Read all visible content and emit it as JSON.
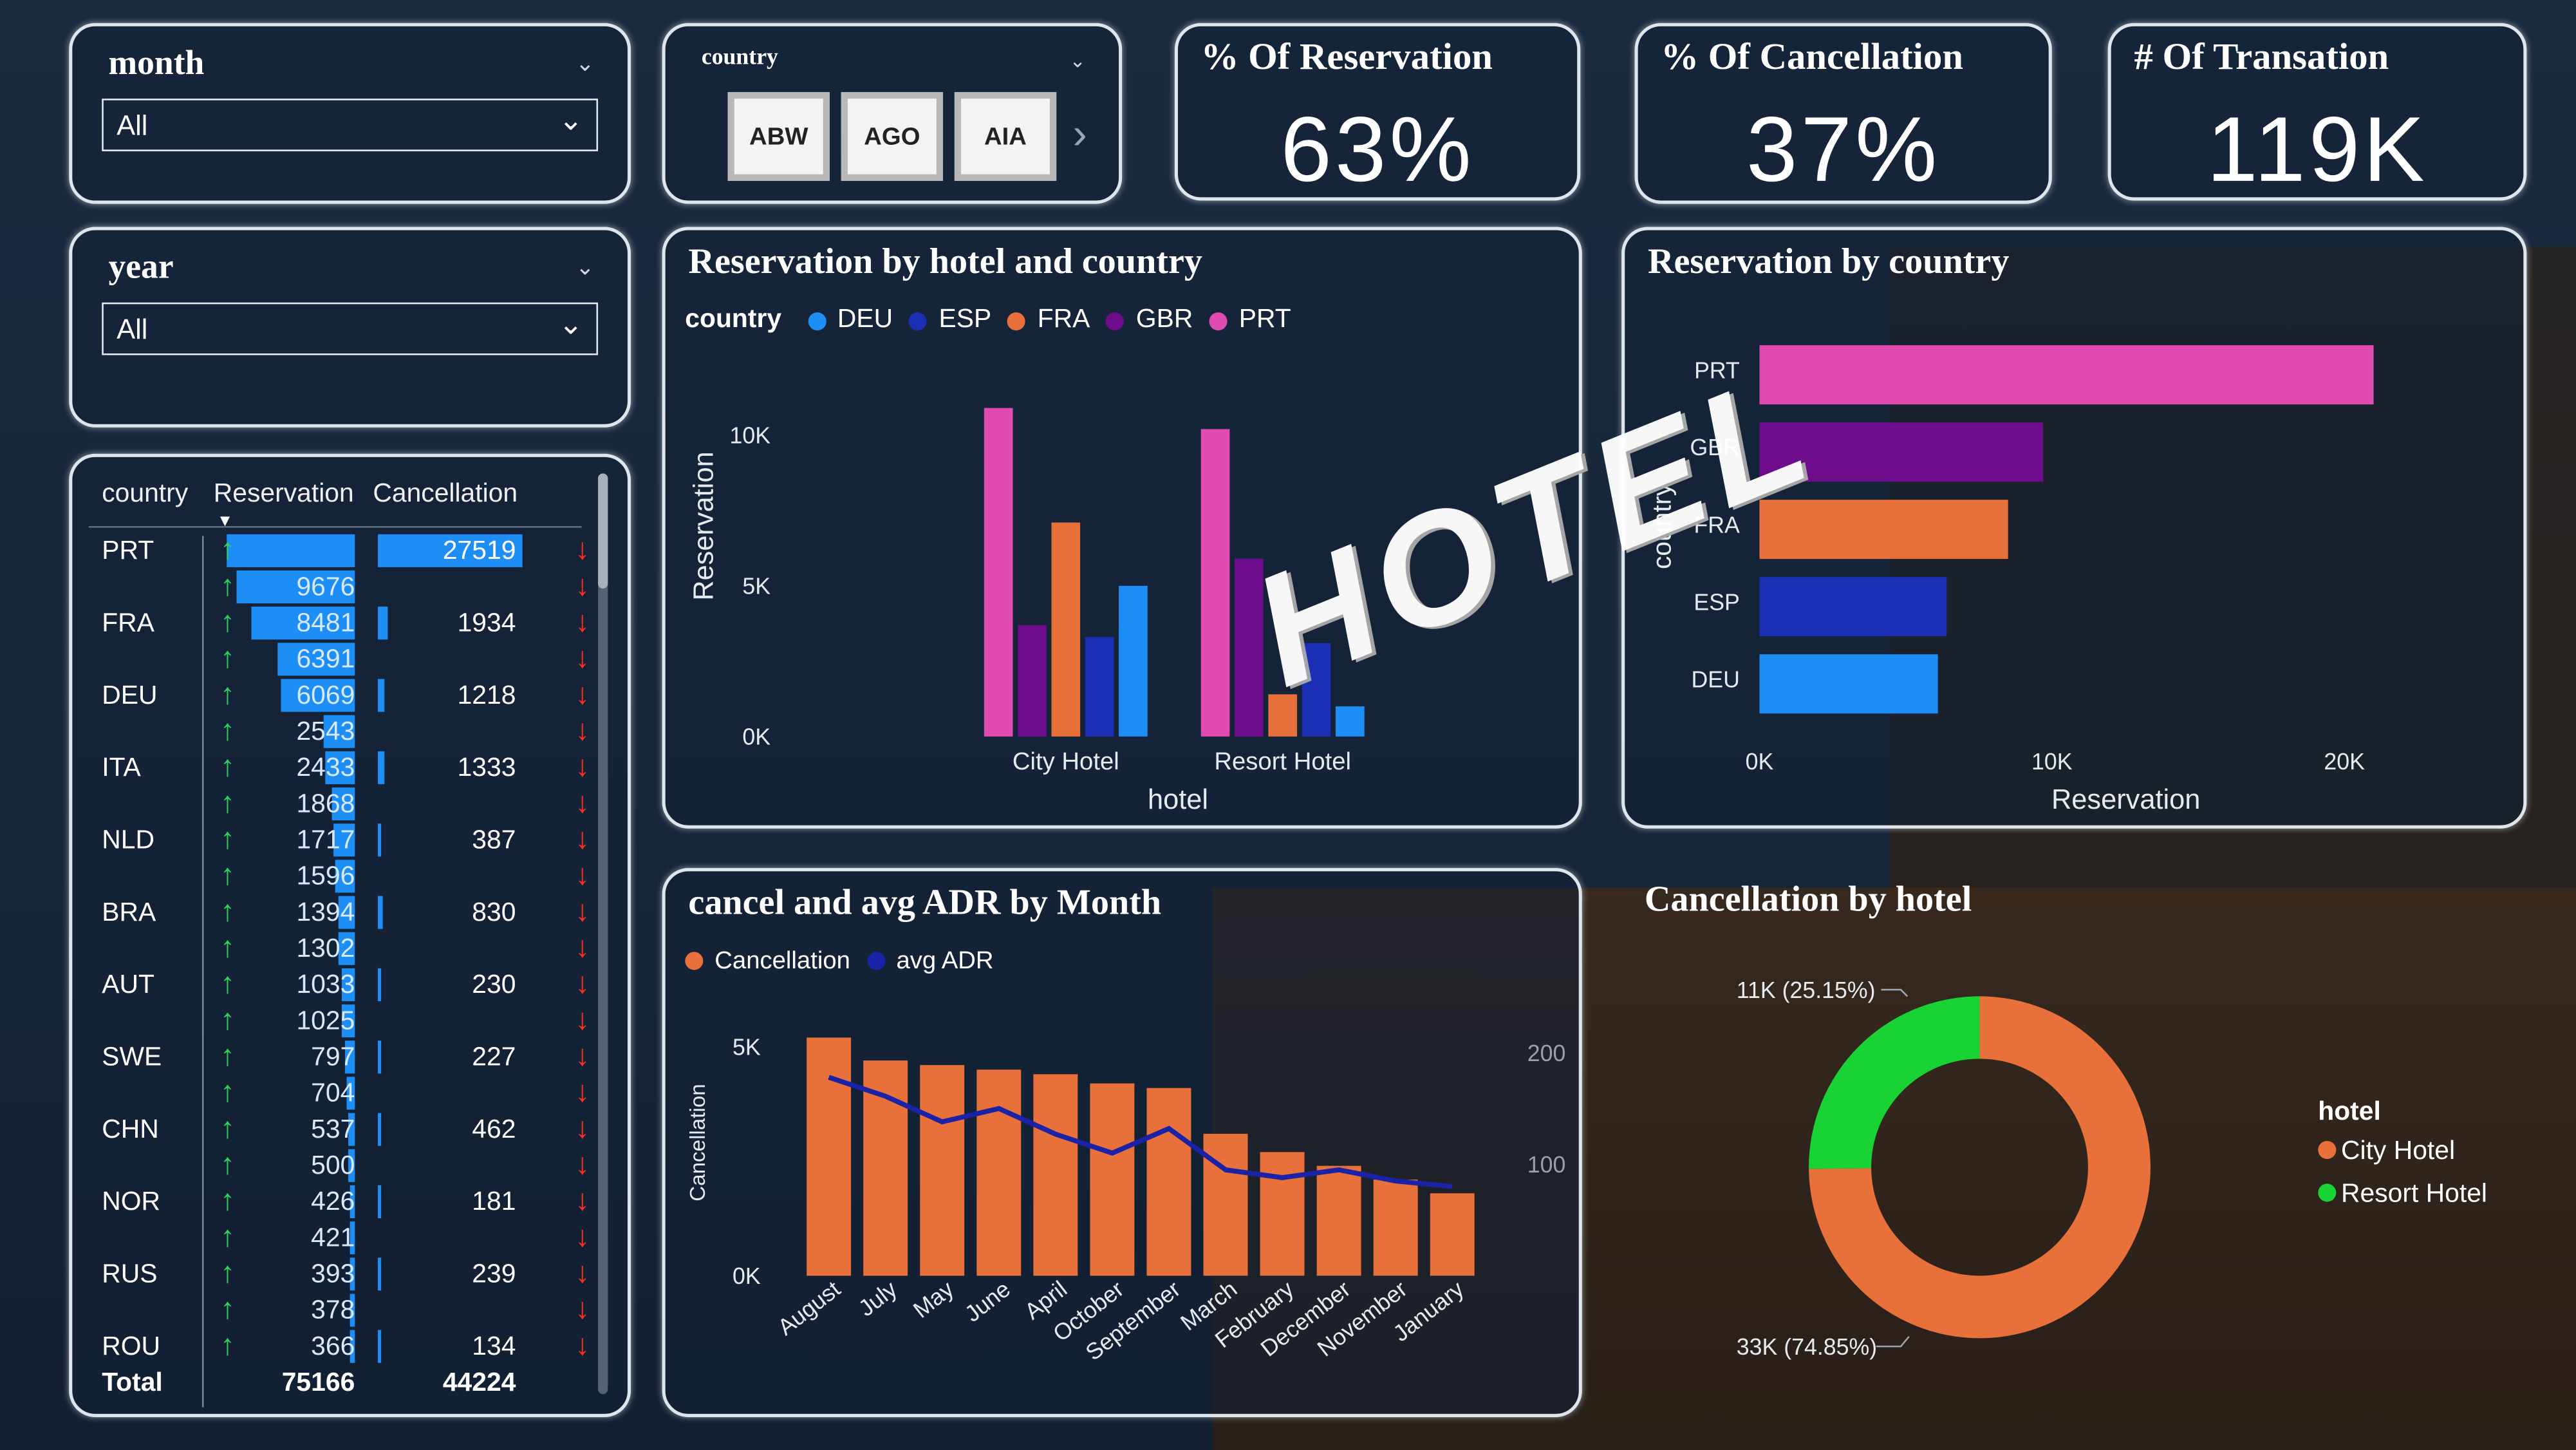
{
  "colors": {
    "DEU": "#1d8ef5",
    "ESP": "#1a2fb3",
    "FRA": "#e8703a",
    "GBR": "#6e0d8c",
    "PRT": "#e04bb2",
    "cancellation": "#e8703a",
    "avg_adr": "#1a22a8",
    "city_hotel": "#e8703a",
    "resort_hotel": "#19d233",
    "arrow_up": "#2fd35a",
    "arrow_down": "#ff2d1f",
    "bar_blue": "#1d8ef5"
  },
  "slicers": {
    "month": {
      "title": "month",
      "value": "All"
    },
    "year": {
      "title": "year",
      "value": "All"
    },
    "country": {
      "title": "country",
      "buttons": [
        "ABW",
        "AGO",
        "AIA"
      ]
    }
  },
  "kpis": {
    "reservation": {
      "title": "% Of Reservation",
      "value": "63%"
    },
    "cancellation": {
      "title": "% Of Cancellation",
      "value": "37%"
    },
    "transactions": {
      "title": "# Of Transation",
      "value": "119K"
    }
  },
  "table": {
    "headers": [
      "country",
      "Reservation",
      "Cancellation"
    ],
    "rows": [
      {
        "country": "PRT",
        "reservation": "",
        "cancellation": "27519"
      },
      {
        "country": "",
        "reservation": "9676",
        "cancellation": ""
      },
      {
        "country": "FRA",
        "reservation": "8481",
        "cancellation": "1934"
      },
      {
        "country": "",
        "reservation": "6391",
        "cancellation": ""
      },
      {
        "country": "DEU",
        "reservation": "6069",
        "cancellation": "1218"
      },
      {
        "country": "",
        "reservation": "2543",
        "cancellation": ""
      },
      {
        "country": "ITA",
        "reservation": "2433",
        "cancellation": "1333"
      },
      {
        "country": "",
        "reservation": "1868",
        "cancellation": ""
      },
      {
        "country": "NLD",
        "reservation": "1717",
        "cancellation": "387"
      },
      {
        "country": "",
        "reservation": "1596",
        "cancellation": ""
      },
      {
        "country": "BRA",
        "reservation": "1394",
        "cancellation": "830"
      },
      {
        "country": "",
        "reservation": "1302",
        "cancellation": ""
      },
      {
        "country": "AUT",
        "reservation": "1033",
        "cancellation": "230"
      },
      {
        "country": "",
        "reservation": "1025",
        "cancellation": ""
      },
      {
        "country": "SWE",
        "reservation": "797",
        "cancellation": "227"
      },
      {
        "country": "",
        "reservation": "704",
        "cancellation": ""
      },
      {
        "country": "CHN",
        "reservation": "537",
        "cancellation": "462"
      },
      {
        "country": "",
        "reservation": "500",
        "cancellation": ""
      },
      {
        "country": "NOR",
        "reservation": "426",
        "cancellation": "181"
      },
      {
        "country": "",
        "reservation": "421",
        "cancellation": ""
      },
      {
        "country": "RUS",
        "reservation": "393",
        "cancellation": "239"
      },
      {
        "country": "",
        "reservation": "378",
        "cancellation": ""
      },
      {
        "country": "ROU",
        "reservation": "366",
        "cancellation": "134"
      }
    ],
    "total": {
      "label": "Total",
      "reservation": "75166",
      "cancellation": "44224"
    }
  },
  "overlay_text": "HOTEL",
  "chart_data": [
    {
      "type": "bar",
      "title": "Reservation by hotel and country",
      "legend_title": "country",
      "categories": [
        "City Hotel",
        "Resort Hotel"
      ],
      "series": [
        {
          "name": "PRT",
          "values": [
            10900,
            10200
          ]
        },
        {
          "name": "GBR",
          "values": [
            3700,
            5900
          ]
        },
        {
          "name": "FRA",
          "values": [
            7100,
            1400
          ]
        },
        {
          "name": "ESP",
          "values": [
            3300,
            3100
          ]
        },
        {
          "name": "DEU",
          "values": [
            5000,
            1000
          ]
        }
      ],
      "xlabel": "hotel",
      "ylabel": "Reservation",
      "ylim": [
        0,
        12000
      ],
      "yticks": [
        "0K",
        "5K",
        "10K"
      ],
      "legend_position": "top-left"
    },
    {
      "type": "bar",
      "orientation": "horizontal",
      "title": "Reservation by country",
      "categories": [
        "PRT",
        "GBR",
        "FRA",
        "ESP",
        "DEU"
      ],
      "values": [
        21000,
        9700,
        8500,
        6400,
        6100
      ],
      "xlabel": "Reservation",
      "ylabel": "country",
      "xlim": [
        0,
        22000
      ],
      "xticks": [
        "0K",
        "10K",
        "20K"
      ]
    },
    {
      "type": "bar",
      "title": "cancel and avg ADR by Month",
      "categories": [
        "August",
        "July",
        "May",
        "June",
        "April",
        "October",
        "September",
        "March",
        "February",
        "December",
        "November",
        "January"
      ],
      "series": [
        {
          "name": "Cancellation",
          "type": "bar",
          "axis": "left",
          "values": [
            5200,
            4700,
            4600,
            4500,
            4400,
            4200,
            4100,
            3100,
            2700,
            2400,
            2100,
            1800
          ]
        },
        {
          "name": "avg ADR",
          "type": "line",
          "axis": "right",
          "values": [
            178,
            161,
            138,
            150,
            127,
            110,
            132,
            95,
            88,
            95,
            85,
            80
          ]
        }
      ],
      "ylabel": "Cancellation",
      "ylim": [
        0,
        6000
      ],
      "yticks": [
        "0K",
        "5K"
      ],
      "y2lim": [
        0,
        220
      ],
      "y2ticks": [
        "100",
        "200"
      ],
      "legend_position": "top-left"
    },
    {
      "type": "pie",
      "donut": true,
      "title": "Cancellation by hotel",
      "legend_title": "hotel",
      "labels": [
        "City Hotel",
        "Resort Hotel"
      ],
      "values": [
        74.85,
        25.15
      ],
      "data_labels": [
        "33K (74.85%)",
        "11K (25.15%)"
      ],
      "legend_position": "right"
    }
  ]
}
